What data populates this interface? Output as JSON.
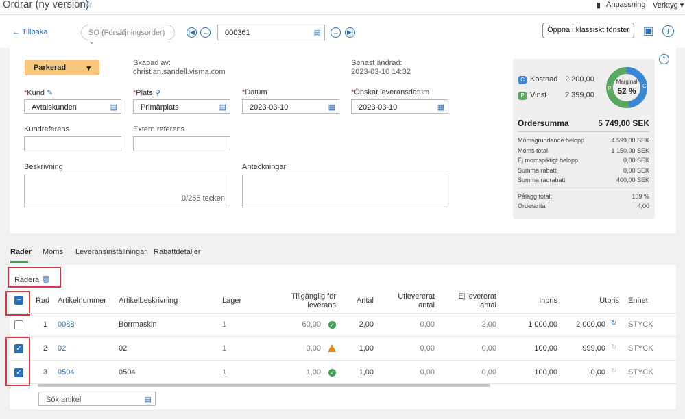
{
  "header": {
    "title": "Ordrar (ny version)",
    "customize": "Anpassning",
    "tools": "Verktyg"
  },
  "nav": {
    "back": "Tillbaka",
    "order_type": "SO (Försäljningsorder)",
    "order_number": "000361",
    "open_classic": "Öppna i klassiskt fönster"
  },
  "form": {
    "status": "Parkerad",
    "created_by_label": "Skapad av:",
    "created_by": "christian.sandell.visma.com",
    "modified_label": "Senast ändrad:",
    "modified": "2023-03-10 14:32",
    "customer_label": "Kund",
    "customer": "Avtalskunden",
    "site_label": "Plats",
    "site": "Primärplats",
    "date_label": "Datum",
    "date": "2023-03-10",
    "delivery_label": "Önskat leveransdatum",
    "delivery": "2023-03-10",
    "customer_ref_label": "Kundreferens",
    "external_ref_label": "Extern referens",
    "description_label": "Beskrivning",
    "char_count": "0/255 tecken",
    "notes_label": "Anteckningar"
  },
  "summary": {
    "cost_label": "Kostnad",
    "cost": "2 200,00",
    "profit_label": "Vinst",
    "profit": "2 399,00",
    "margin_label": "Marginal",
    "margin": "52 %",
    "margin_fraction": 0.52,
    "total_label": "Ordersumma",
    "total": "5 749,00 SEK",
    "rows": [
      {
        "label": "Momsgrundande belopp",
        "value": "4 599,00 SEK"
      },
      {
        "label": "Moms total",
        "value": "1 150,00 SEK"
      },
      {
        "label": "Ej momspiktigt belopp",
        "value": "0,00 SEK"
      },
      {
        "label": "Summa rabatt",
        "value": "0,00 SEK"
      },
      {
        "label": "Summa radrabatt",
        "value": "400,00 SEK"
      }
    ],
    "rows2": [
      {
        "label": "Pålägg totalt",
        "value": "109 %"
      },
      {
        "label": "Orderantal",
        "value": "4,00"
      }
    ],
    "colors": {
      "cost": "#3a88d4",
      "profit": "#5aa860"
    }
  },
  "tabs": [
    "Rader",
    "Moms",
    "Leveransinställningar",
    "Rabattdetaljer"
  ],
  "grid": {
    "delete_label": "Radera",
    "columns": {
      "rad": "Rad",
      "artnr": "Artikelnummer",
      "artdesc": "Artikelbeskrivning",
      "lager": "Lager",
      "avail1": "Tillgänglig för",
      "avail2": "leverans",
      "antal": "Antal",
      "utlev1": "Utlevererat",
      "utlev2": "antal",
      "ejlev1": "Ej levererat",
      "ejlev2": "antal",
      "inpris": "Inpris",
      "utpris": "Utpris",
      "enhet": "Enhet"
    },
    "rows": [
      {
        "rad": "1",
        "artnr": "0088",
        "desc": "Borrmaskin",
        "lager": "1",
        "avail": "60,00",
        "antal": "2,00",
        "utlev": "0,00",
        "ejlev": "2,00",
        "inpris": "1 000,00",
        "utpris": "2 000,00",
        "enhet": "STYCK"
      },
      {
        "rad": "2",
        "artnr": "02",
        "desc": "02",
        "lager": "1",
        "avail": "0,00",
        "antal": "1,00",
        "utlev": "0,00",
        "ejlev": "0,00",
        "inpris": "100,00",
        "utpris": "999,00",
        "enhet": "STYCK"
      },
      {
        "rad": "3",
        "artnr": "0504",
        "desc": "0504",
        "lager": "1",
        "avail": "1,00",
        "antal": "1,00",
        "utlev": "0,00",
        "ejlev": "0,00",
        "inpris": "100,00",
        "utpris": "0,00",
        "enhet": "STYCK"
      }
    ],
    "search_placeholder": "Sök artikel"
  }
}
